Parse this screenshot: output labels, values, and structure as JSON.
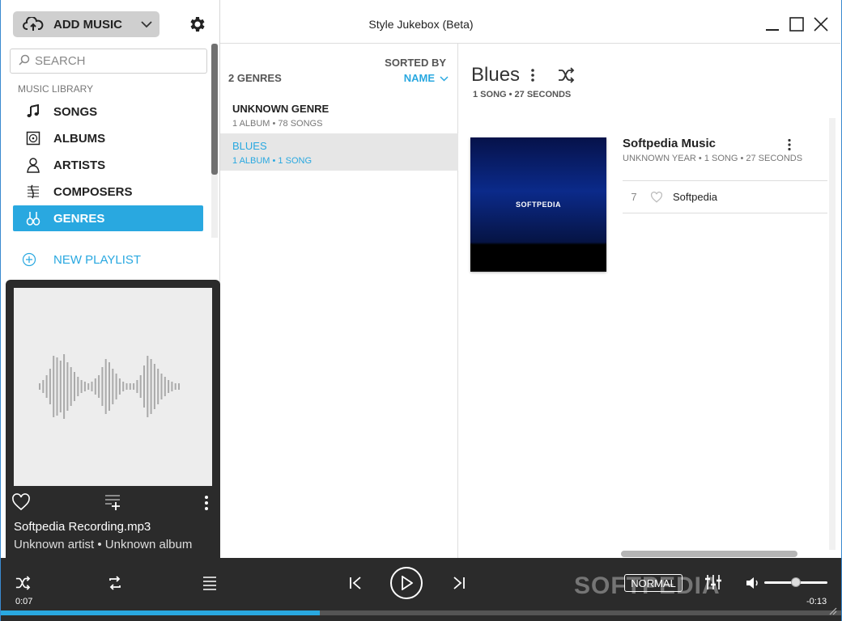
{
  "app_title": "Style Jukebox (Beta)",
  "sidebar": {
    "add_music": "ADD MUSIC",
    "search_placeholder": "SEARCH",
    "library_label": "MUSIC LIBRARY",
    "items": [
      {
        "label": "SONGS",
        "icon": "music-note-icon"
      },
      {
        "label": "ALBUMS",
        "icon": "album-icon"
      },
      {
        "label": "ARTISTS",
        "icon": "artist-icon"
      },
      {
        "label": "COMPOSERS",
        "icon": "composer-icon"
      },
      {
        "label": "GENRES",
        "icon": "genres-icon",
        "active": true
      }
    ],
    "new_playlist": "NEW PLAYLIST"
  },
  "now_playing": {
    "title": "Softpedia Recording.mp3",
    "subtitle": "Unknown artist • Unknown album"
  },
  "genres_panel": {
    "count_label": "2 GENRES",
    "sorted_by_label": "SORTED BY",
    "sort_value": "NAME",
    "rows": [
      {
        "name": "UNKNOWN GENRE",
        "meta": "1 ALBUM • 78 SONGS"
      },
      {
        "name": "BLUES",
        "meta": "1 ALBUM • 1 SONG",
        "selected": true
      }
    ]
  },
  "detail": {
    "title": "Blues",
    "stats": "1 SONG • 27 SECONDS",
    "album": {
      "art_text": "SOFTPEDIA",
      "title": "Softpedia Music",
      "meta": "UNKNOWN YEAR • 1 SONG • 27 SECONDS"
    },
    "tracks": [
      {
        "number": "7",
        "name": "Softpedia"
      }
    ]
  },
  "player": {
    "time_current": "0:07",
    "time_remaining": "-0:13",
    "mode": "NORMAL",
    "progress_fraction": 0.38,
    "volume_fraction": 0.5,
    "watermark": "SOFTPEDIA"
  },
  "colors": {
    "accent": "#29a8e0",
    "dark": "#2b2b2b"
  }
}
